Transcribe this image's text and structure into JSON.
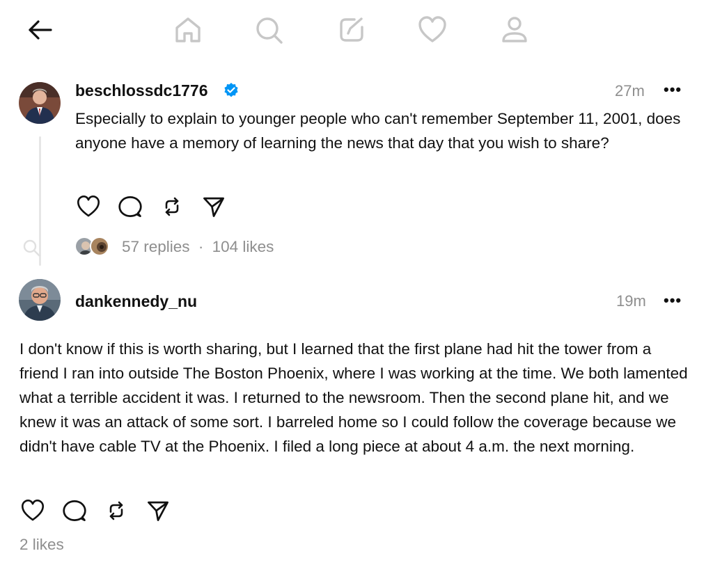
{
  "nav": {
    "back": "back-arrow-icon",
    "items": [
      "home-icon",
      "search-icon",
      "compose-icon",
      "activity-heart-icon",
      "profile-icon"
    ],
    "icon_color": "#c7c7c7"
  },
  "post": {
    "username": "beschlossdc1776",
    "verified": true,
    "verified_color": "#0095f6",
    "timestamp": "27m",
    "more": "•••",
    "text": "Especially to explain to younger people who can't remember September 11, 2001, does anyone have a memory of learning the news that day that you wish to share?",
    "actions": [
      "like-icon",
      "comment-icon",
      "repost-icon",
      "share-icon"
    ],
    "replies": "57 replies",
    "separator": "·",
    "likes": "104 likes"
  },
  "reply": {
    "username": "dankennedy_nu",
    "timestamp": "19m",
    "more": "•••",
    "text": "I don't know if this is worth sharing, but I learned that the first plane had hit the tower from a friend I ran into outside The Boston Phoenix, where I was working at the time. We both lamented what a terrible accident it was. I returned to the newsroom. Then the second plane hit, and we knew it was an attack of some sort. I barreled home so I could follow the coverage because we didn't have cable TV at the Phoenix. I filed a long piece at about 4 a.m. the next morning.",
    "actions": [
      "like-icon",
      "comment-icon",
      "repost-icon",
      "share-icon"
    ],
    "likes": "2 likes"
  }
}
